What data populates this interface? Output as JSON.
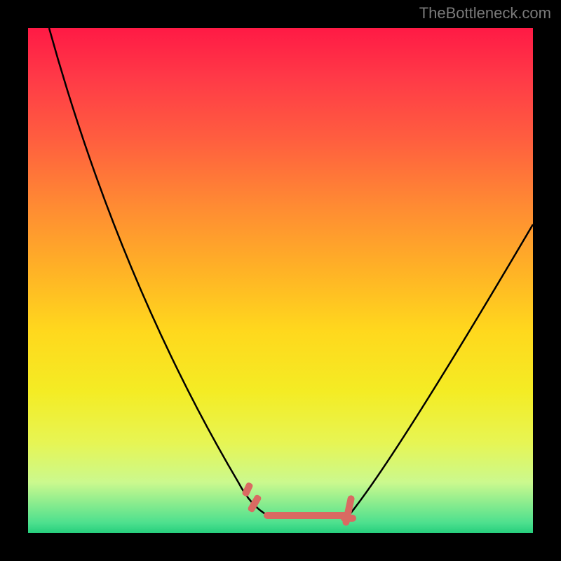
{
  "watermark": "TheBottleneck.com",
  "colors": {
    "background": "#000000",
    "gradient_top": "#ff1a45",
    "gradient_bottom": "#26cf7d",
    "curve": "#000000",
    "highlight": "#d96a62",
    "watermark": "#7a7a7a"
  },
  "chart_data": {
    "type": "line",
    "title": "",
    "xlabel": "",
    "ylabel": "",
    "xlim": [
      0,
      100
    ],
    "ylim": [
      0,
      100
    ],
    "note": "No axes or tick labels are rendered. The plot shows a V-shaped black curve over a red-to-green vertical gradient with a small salmon-colored highlight near the valley. x and y are estimated from gridline-free pixel positions as percentages of the plot area (0,0 at bottom-left).",
    "series": [
      {
        "name": "curve",
        "x": [
          4,
          10,
          18,
          26,
          34,
          42,
          48,
          52,
          56,
          60,
          64,
          72,
          80,
          88,
          96,
          100
        ],
        "y": [
          100,
          78,
          58,
          42,
          28,
          16,
          6,
          2,
          1,
          2,
          3,
          12,
          28,
          44,
          56,
          62
        ]
      },
      {
        "name": "highlighted-region",
        "x": [
          44,
          48,
          52,
          56,
          60,
          64
        ],
        "y": [
          8,
          4,
          2,
          1,
          2,
          5
        ]
      }
    ],
    "legend": false,
    "grid": false
  }
}
